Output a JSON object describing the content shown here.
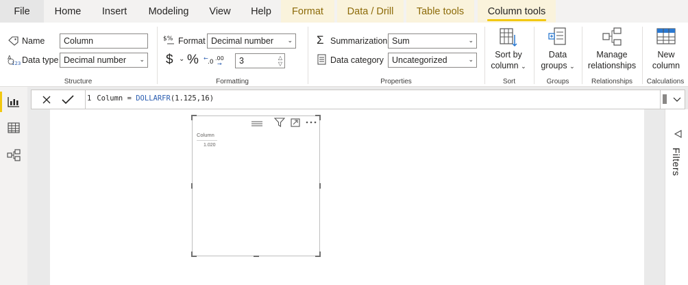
{
  "tabs": [
    {
      "label": "File"
    },
    {
      "label": "Home"
    },
    {
      "label": "Insert"
    },
    {
      "label": "Modeling"
    },
    {
      "label": "View"
    },
    {
      "label": "Help"
    },
    {
      "label": "Format"
    },
    {
      "label": "Data / Drill"
    },
    {
      "label": "Table tools"
    },
    {
      "label": "Column tools"
    }
  ],
  "ribbon": {
    "structure": {
      "name_label": "Name",
      "name_value": "Column",
      "datatype_label": "Data type",
      "datatype_value": "Decimal number",
      "group_label": "Structure"
    },
    "formatting": {
      "format_label": "Format",
      "format_value": "Decimal number",
      "currency_symbol": "$",
      "percent_symbol": "%",
      "decimals_value": "3",
      "group_label": "Formatting"
    },
    "properties": {
      "summarization_label": "Summarization",
      "summarization_value": "Sum",
      "category_label": "Data category",
      "category_value": "Uncategorized",
      "group_label": "Properties"
    },
    "sort": {
      "line1": "Sort by",
      "line2": "column",
      "group_label": "Sort"
    },
    "groups": {
      "line1": "Data",
      "line2": "groups",
      "group_label": "Groups"
    },
    "relationships": {
      "line1": "Manage",
      "line2": "relationships",
      "group_label": "Relationships"
    },
    "calculations": {
      "line1": "New",
      "line2": "column",
      "group_label": "Calculations"
    }
  },
  "formula": {
    "line_number": "1",
    "prefix": "Column = ",
    "function": "DOLLARFR",
    "args": "(1.125,16)"
  },
  "visual": {
    "header": "Column",
    "value": "1.020"
  },
  "filters": {
    "label": "Filters"
  },
  "colors": {
    "accent": "#f2c811",
    "context_tab_text": "#8c6a08",
    "function_blue": "#2a5db0"
  }
}
